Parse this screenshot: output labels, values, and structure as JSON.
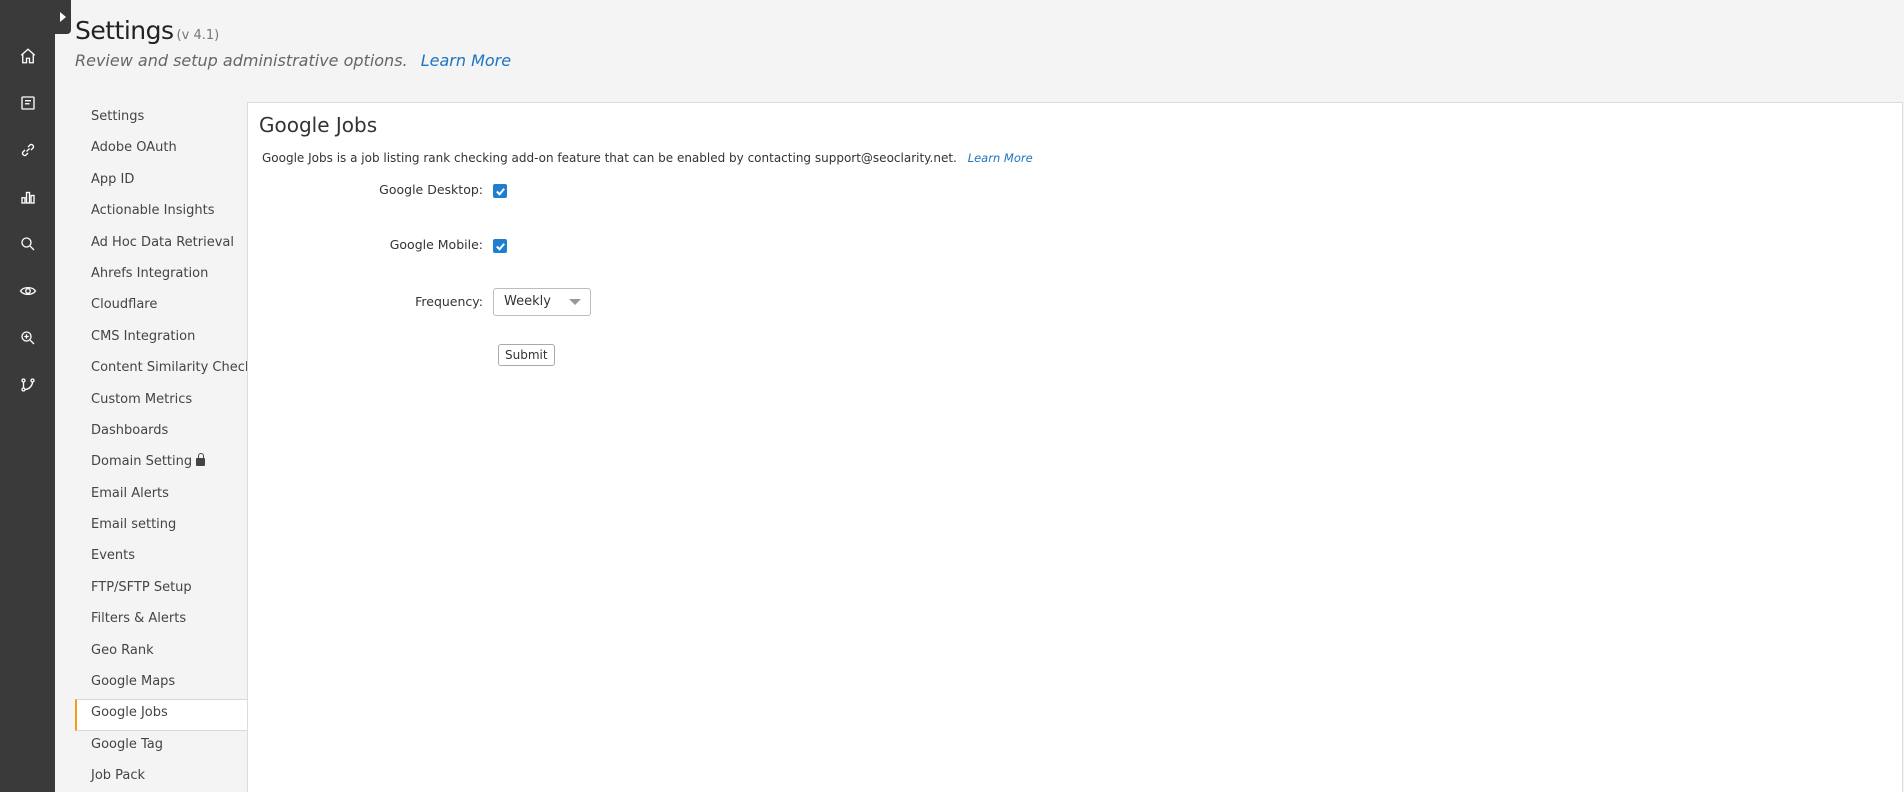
{
  "header": {
    "title": "Settings",
    "version": "(v 4.1)",
    "subtitle": "Review and setup administrative options.",
    "learn_more": "Learn More"
  },
  "leftnav": {
    "icons": [
      "home-icon",
      "report-icon",
      "link-icon",
      "chart-icon",
      "search-icon",
      "view-icon",
      "ai-search-icon",
      "network-icon"
    ]
  },
  "sidebar": {
    "items": [
      {
        "label": "Settings"
      },
      {
        "label": "Adobe OAuth"
      },
      {
        "label": "App ID"
      },
      {
        "label": "Actionable Insights"
      },
      {
        "label": "Ad Hoc Data Retrieval"
      },
      {
        "label": "Ahrefs Integration"
      },
      {
        "label": "Cloudflare"
      },
      {
        "label": "CMS Integration"
      },
      {
        "label": "Content Similarity Check"
      },
      {
        "label": "Custom Metrics"
      },
      {
        "label": "Dashboards"
      },
      {
        "label": "Domain Setting",
        "locked": true
      },
      {
        "label": "Email Alerts"
      },
      {
        "label": "Email setting"
      },
      {
        "label": "Events"
      },
      {
        "label": "FTP/SFTP Setup"
      },
      {
        "label": "Filters & Alerts"
      },
      {
        "label": "Geo Rank"
      },
      {
        "label": "Google Maps"
      },
      {
        "label": "Google Jobs",
        "active": true
      },
      {
        "label": "Google Tag"
      },
      {
        "label": "Job Pack"
      }
    ]
  },
  "panel": {
    "title": "Google Jobs",
    "description": "Google Jobs is a job listing rank checking add-on feature that can be enabled by contacting support@seoclarity.net.",
    "learn_more": "Learn More",
    "desktop_label": "Google Desktop:",
    "desktop_checked": true,
    "mobile_label": "Google Mobile:",
    "mobile_checked": true,
    "frequency_label": "Frequency:",
    "frequency_value": "Weekly",
    "submit_label": "Submit"
  },
  "colors": {
    "leftbar": "#3a3a3a",
    "accent_active": "#f59c1a",
    "link": "#1f74c0",
    "checkbox": "#1e7fd0"
  }
}
